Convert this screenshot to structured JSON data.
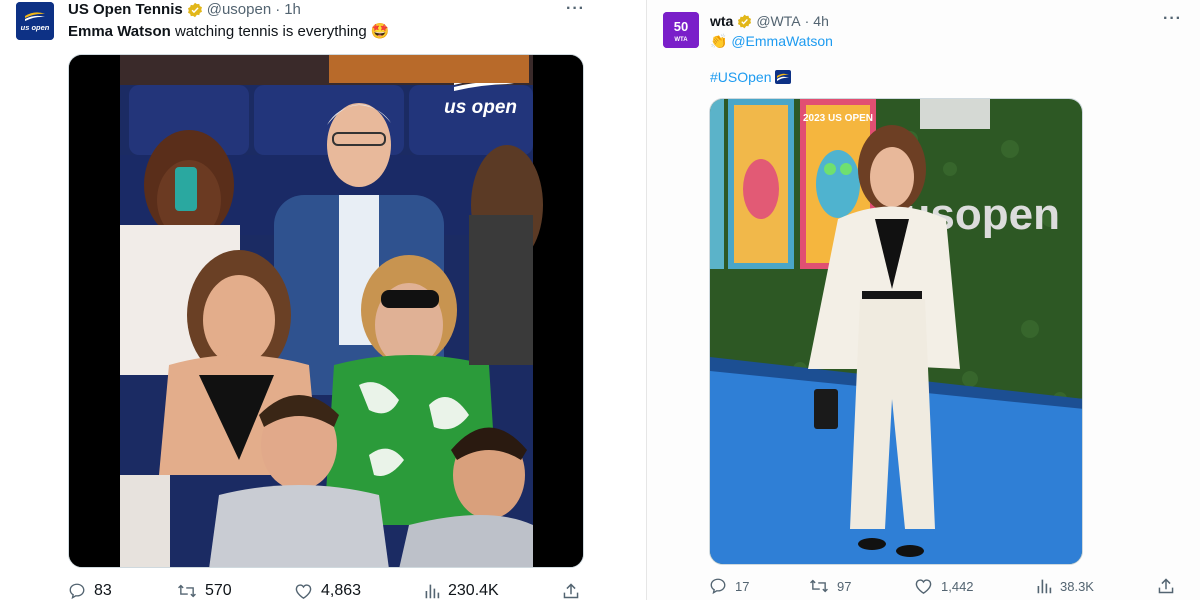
{
  "left_tweet": {
    "avatar_text": "us open",
    "name": "US Open Tennis",
    "handle": "@usopen",
    "separator": "·",
    "time": "1h",
    "more": "···",
    "text_bold": "Emma Watson",
    "text_rest": " watching tennis is everything",
    "emoji": "🤩",
    "media_alt_brand": "us open",
    "actions": {
      "replies": "83",
      "retweets": "570",
      "likes": "4,863",
      "views": "230.4K"
    }
  },
  "right_tweet": {
    "avatar_text": "50",
    "avatar_sub": "WTA",
    "name": "wta",
    "handle": "@WTA",
    "separator": "·",
    "time": "4h",
    "more": "···",
    "clap_emoji": "👏",
    "mention": "@EmmaWatson",
    "hashtag": "#USOpen",
    "media_wall_text": "usopen",
    "media_poster_text": "2023 US OPEN",
    "actions": {
      "replies": "17",
      "retweets": "97",
      "likes": "1,442",
      "views": "38.3K"
    }
  },
  "colors": {
    "text": "#0f1419",
    "muted": "#536471",
    "link": "#1d9bf0",
    "verified_gold": "#e2b719",
    "usopen_blue": "#0d3185",
    "wta_purple": "#7a1fc9",
    "carpet_blue": "#2f7fd6",
    "hedge_green": "#2f5a26"
  },
  "icons": [
    "reply-icon",
    "retweet-icon",
    "like-icon",
    "views-icon",
    "share-icon",
    "verified-badge-icon",
    "more-icon"
  ]
}
